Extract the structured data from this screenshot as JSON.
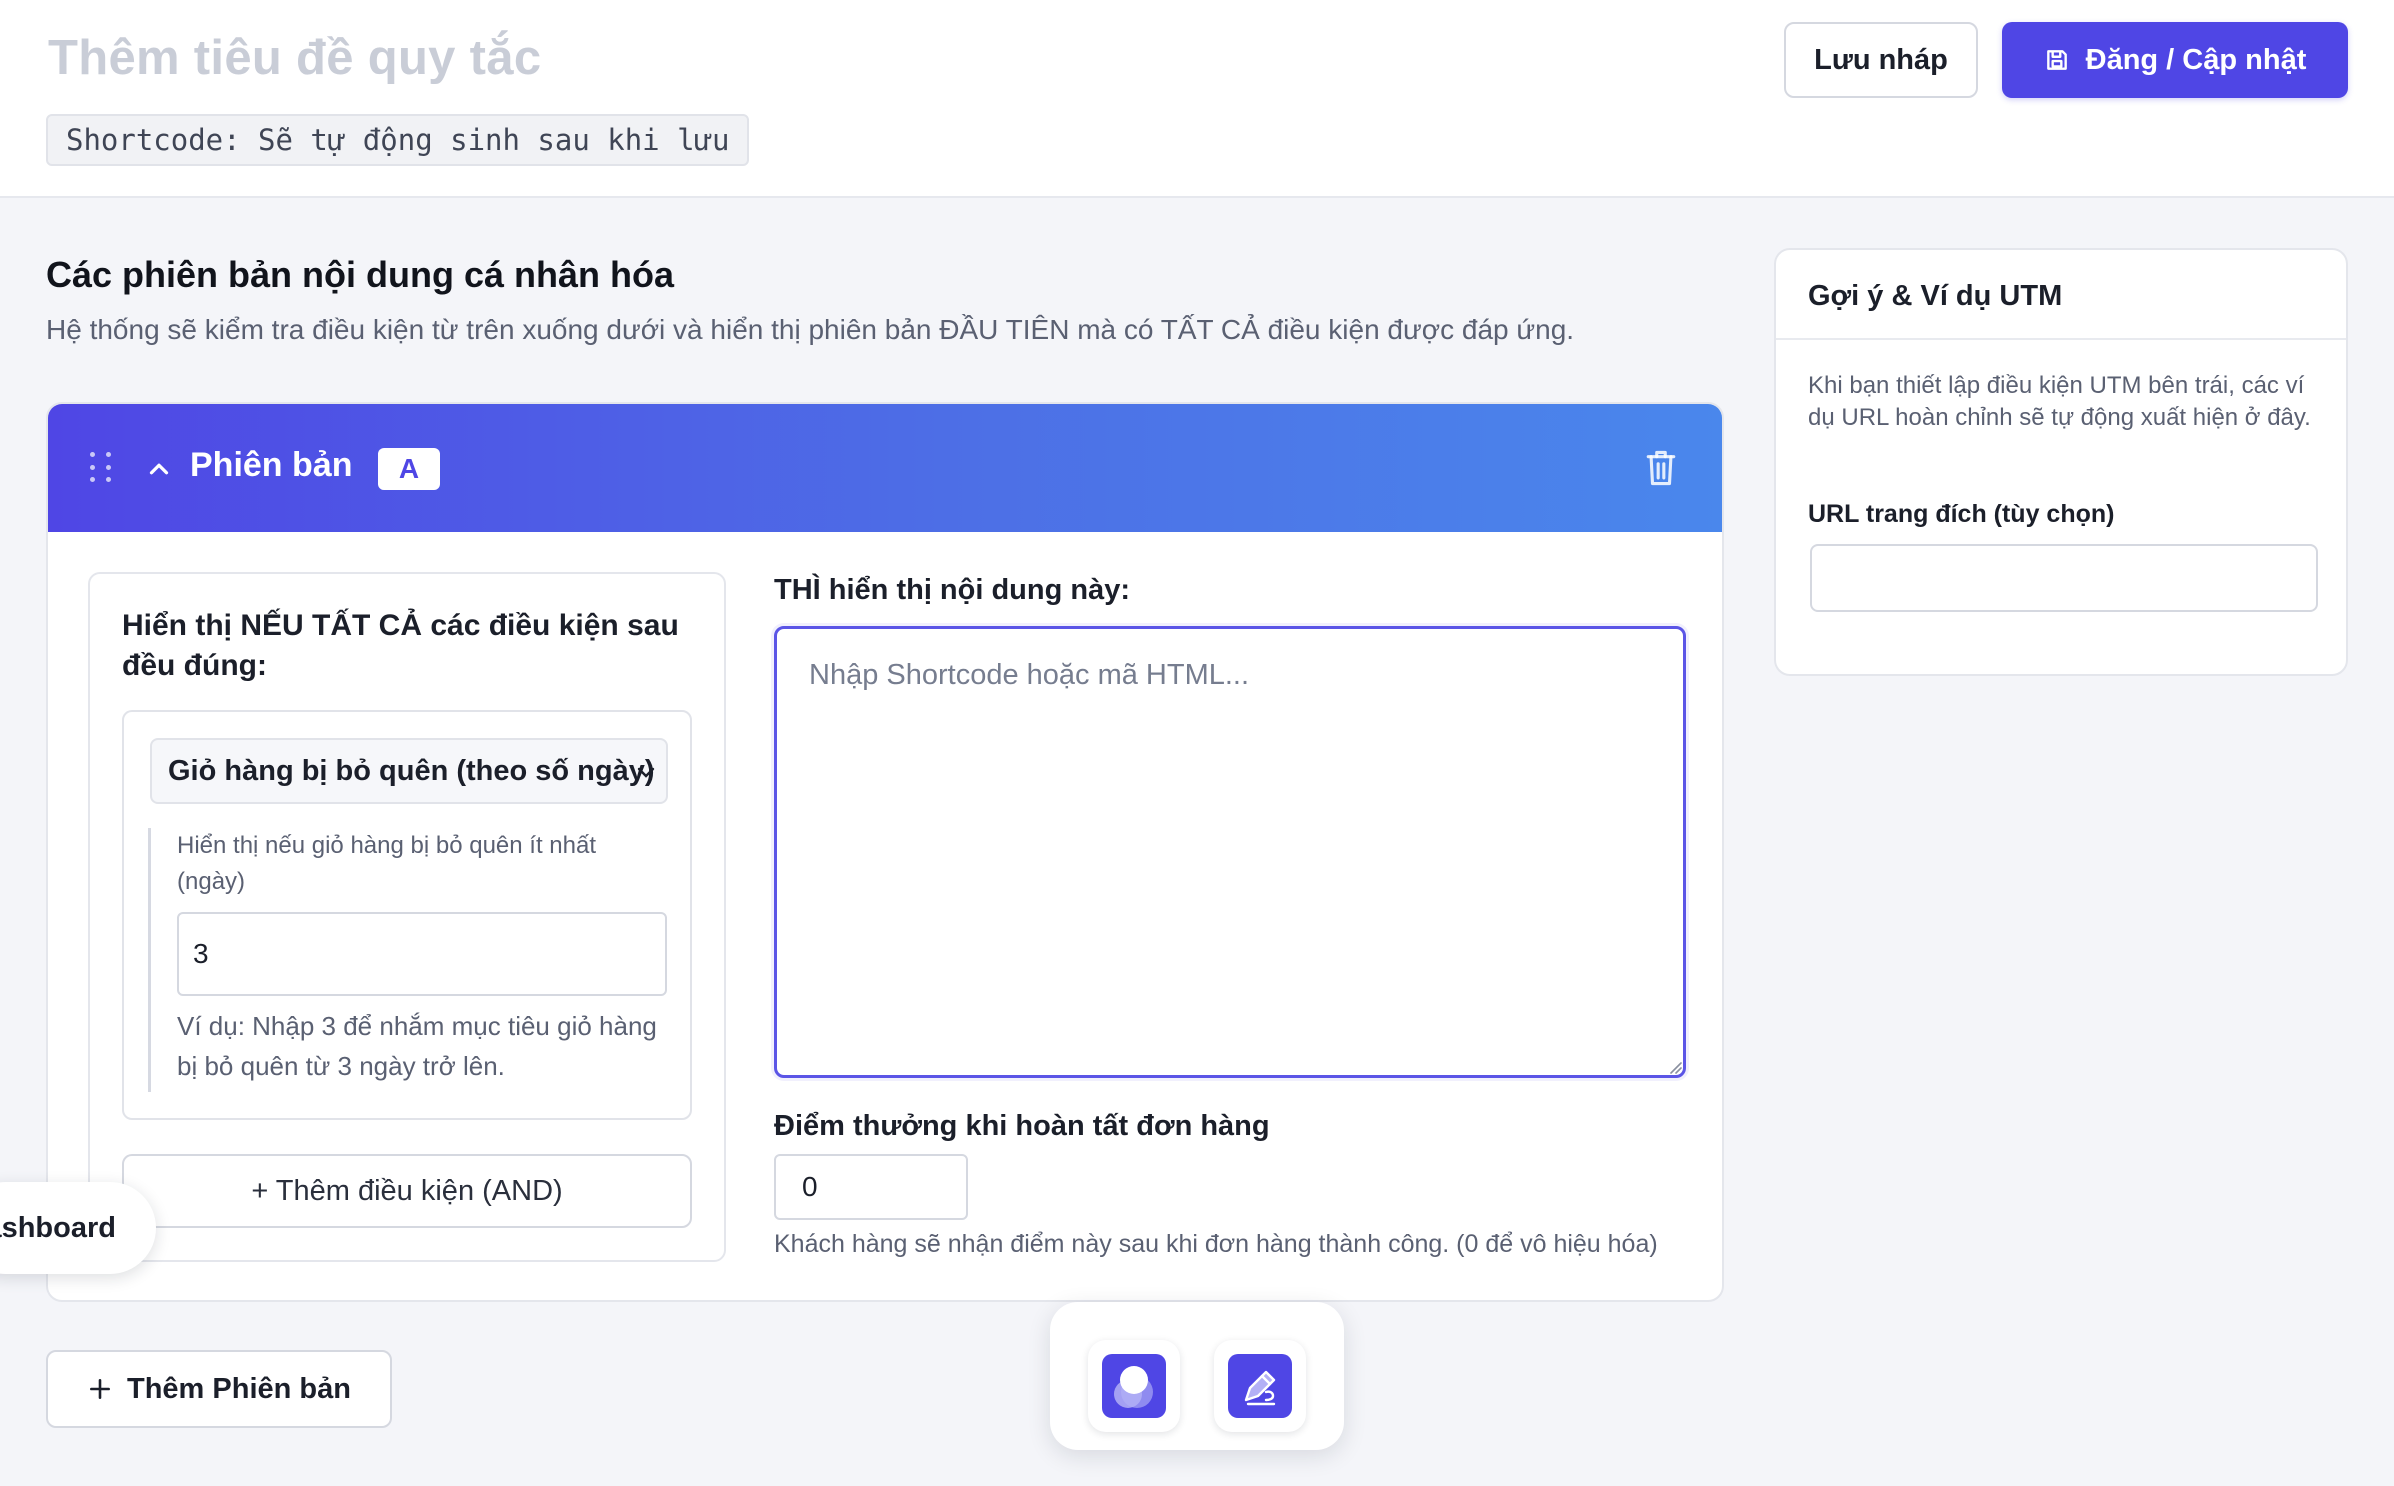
{
  "header": {
    "rule_title": "Thêm tiêu đề quy tắc",
    "shortcode": "Shortcode: Sẽ tự động sinh sau khi lưu",
    "draft_label": "Lưu nháp",
    "publish_label": "Đăng / Cập nhật"
  },
  "section": {
    "title": "Các phiên bản nội dung cá nhân hóa",
    "description": "Hệ thống sẽ kiểm tra điều kiện từ trên xuống dưới và hiển thị phiên bản ĐẦU TIÊN mà có TẤT CẢ điều kiện được đáp ứng."
  },
  "variant": {
    "label": "Phiên bản",
    "badge": "A",
    "conditions": {
      "heading": "Hiển thị NẾU TẤT CẢ các điều kiện sau đều đúng:",
      "selected": "Giỏ hàng bị bỏ quên (theo số ngày)",
      "field_label": "Hiển thị nếu giỏ hàng bị bỏ quên ít nhất (ngày)",
      "field_value": "3",
      "hint": "Ví dụ: Nhập 3 để nhắm mục tiêu giỏ hàng bị bỏ quên từ 3 ngày trở lên.",
      "add_label": "+ Thêm điều kiện (AND)"
    },
    "content": {
      "label": "THÌ hiển thị nội dung này:",
      "placeholder": "Nhập Shortcode hoặc mã HTML...",
      "value": ""
    },
    "points": {
      "label": "Điểm thưởng khi hoàn tất đơn hàng",
      "value": "0",
      "hint": "Khách hàng sẽ nhận điểm này sau khi đơn hàng thành công. (0 để vô hiệu hóa)"
    }
  },
  "add_variant_label": "Thêm Phiên bản",
  "dashboard_label": "Dashboard",
  "sidebar": {
    "title": "Gợi ý & Ví dụ UTM",
    "description": "Khi bạn thiết lập điều kiện UTM bên trái, các ví dụ URL hoàn chỉnh sẽ tự động xuất hiện ở đây.",
    "url_label": "URL trang đích (tùy chọn)",
    "url_value": ""
  },
  "colors": {
    "accent": "#4f46e5",
    "gradient_end": "#4a87ec",
    "background": "#f4f5f9"
  },
  "icons": [
    "drag-handle-icon",
    "chevron-up-icon",
    "trash-icon",
    "save-icon",
    "plus-icon",
    "chevron-down-icon",
    "resize-grip-icon",
    "user-avatar-icon",
    "pen-icon"
  ]
}
